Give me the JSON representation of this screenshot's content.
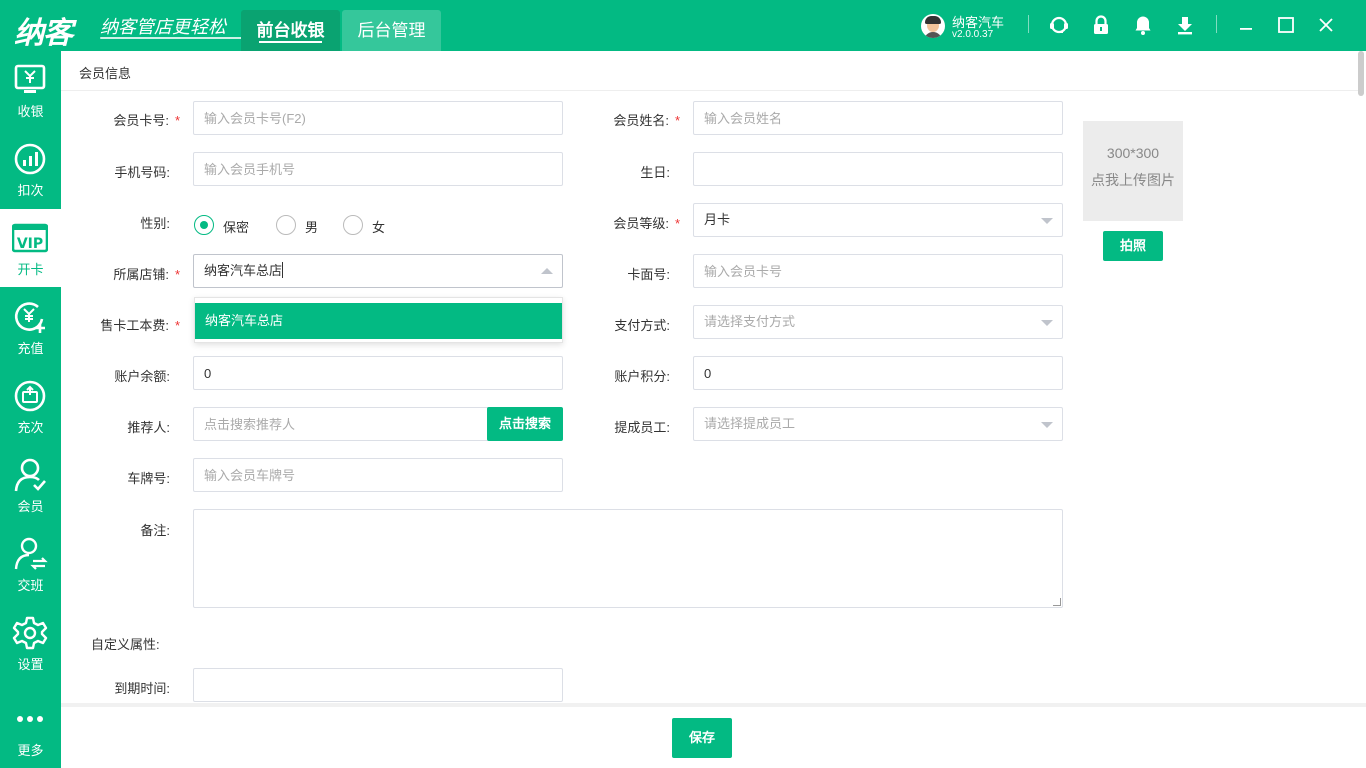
{
  "app": {
    "logo": "纳客",
    "slogan": "纳客管店更轻松",
    "tabs": [
      {
        "label": "前台收银",
        "active": true
      },
      {
        "label": "后台管理",
        "active": false
      }
    ],
    "user": {
      "name": "纳客汽车",
      "version": "v2.0.0.37"
    },
    "brand_color": "#03ba83"
  },
  "sidebar": {
    "items": [
      {
        "label": "收银",
        "icon": "cashier-icon"
      },
      {
        "label": "扣次",
        "icon": "deduct-icon"
      },
      {
        "label": "开卡",
        "icon": "vip-card-icon",
        "active": true
      },
      {
        "label": "充值",
        "icon": "recharge-icon"
      },
      {
        "label": "充次",
        "icon": "recharge-times-icon"
      },
      {
        "label": "会员",
        "icon": "member-icon"
      },
      {
        "label": "交班",
        "icon": "shift-icon"
      },
      {
        "label": "设置",
        "icon": "settings-icon"
      },
      {
        "label": "更多",
        "icon": "more-icon"
      }
    ]
  },
  "form": {
    "section_title": "会员信息",
    "card_no": {
      "label": "会员卡号:",
      "placeholder": "输入会员卡号(F2)"
    },
    "member_name": {
      "label": "会员姓名:",
      "placeholder": "输入会员姓名"
    },
    "phone": {
      "label": "手机号码:",
      "placeholder": "输入会员手机号"
    },
    "birthday": {
      "label": "生日:",
      "value": ""
    },
    "gender": {
      "label": "性别:",
      "options": [
        "保密",
        "男",
        "女"
      ],
      "selected": "保密"
    },
    "level": {
      "label": "会员等级:",
      "value": "月卡"
    },
    "store": {
      "label": "所属店铺:",
      "value": "纳客汽车总店",
      "dropdown_options": [
        "纳客汽车总店"
      ]
    },
    "face_no": {
      "label": "卡面号:",
      "placeholder": "输入会员卡号"
    },
    "card_fee": {
      "label": "售卡工本费:"
    },
    "payment": {
      "label": "支付方式:",
      "placeholder": "请选择支付方式"
    },
    "balance": {
      "label": "账户余额:",
      "value": "0"
    },
    "points": {
      "label": "账户积分:",
      "value": "0"
    },
    "referrer": {
      "label": "推荐人:",
      "placeholder": "点击搜索推荐人",
      "button": "点击搜索"
    },
    "commission_staff": {
      "label": "提成员工:",
      "placeholder": "请选择提成员工"
    },
    "plate": {
      "label": "车牌号:",
      "placeholder": "输入会员车牌号"
    },
    "remark": {
      "label": "备注:",
      "value": ""
    },
    "custom_title": "自定义属性:",
    "expire": {
      "label": "到期时间:",
      "value": ""
    },
    "photo": {
      "size": "300*300",
      "hint": "点我上传图片",
      "button": "拍照"
    },
    "save_button": "保存"
  }
}
